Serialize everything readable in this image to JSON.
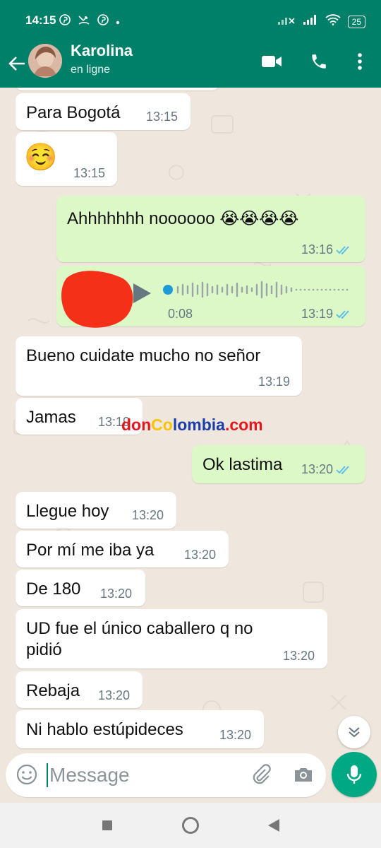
{
  "status_bar": {
    "time": "14:15",
    "battery": "25"
  },
  "header": {
    "contact_name": "Karolina",
    "contact_status": "en ligne"
  },
  "messages": [
    {
      "text": "Para Bogotá",
      "time": "13:15"
    },
    {
      "text": "☺️",
      "time": "13:15"
    },
    {
      "text": "Ahhhhhhh noooooo 😭😭😭😭",
      "time": "13:16"
    },
    {
      "duration": "0:08",
      "time": "13:19"
    },
    {
      "text": "Bueno cuidate mucho no señor",
      "time": "13:19"
    },
    {
      "text": "Jamas",
      "time": "13:19"
    },
    {
      "text": "Ok lastima",
      "time": "13:20"
    },
    {
      "text": "Llegue hoy",
      "time": "13:20"
    },
    {
      "text": "Por mí me iba ya",
      "time": "13:20"
    },
    {
      "text": "De 180",
      "time": "13:20"
    },
    {
      "text_line1": "UD fue el único caballero q no",
      "text_line2": "pidió",
      "time": "13:20"
    },
    {
      "text": "Rebaja",
      "time": "13:20"
    },
    {
      "text": "Ni hablo estúpideces",
      "time": "13:20"
    }
  ],
  "watermark": {
    "part1": "don",
    "part2": "Co",
    "part3": "lombia",
    "part4": ".com"
  },
  "composer": {
    "placeholder": "Message"
  },
  "colors": {
    "header": "#008069",
    "outgoing_bubble": "#dcf8c6",
    "incoming_bubble": "#ffffff",
    "tick_read": "#53bdeb",
    "mic": "#00a884"
  }
}
